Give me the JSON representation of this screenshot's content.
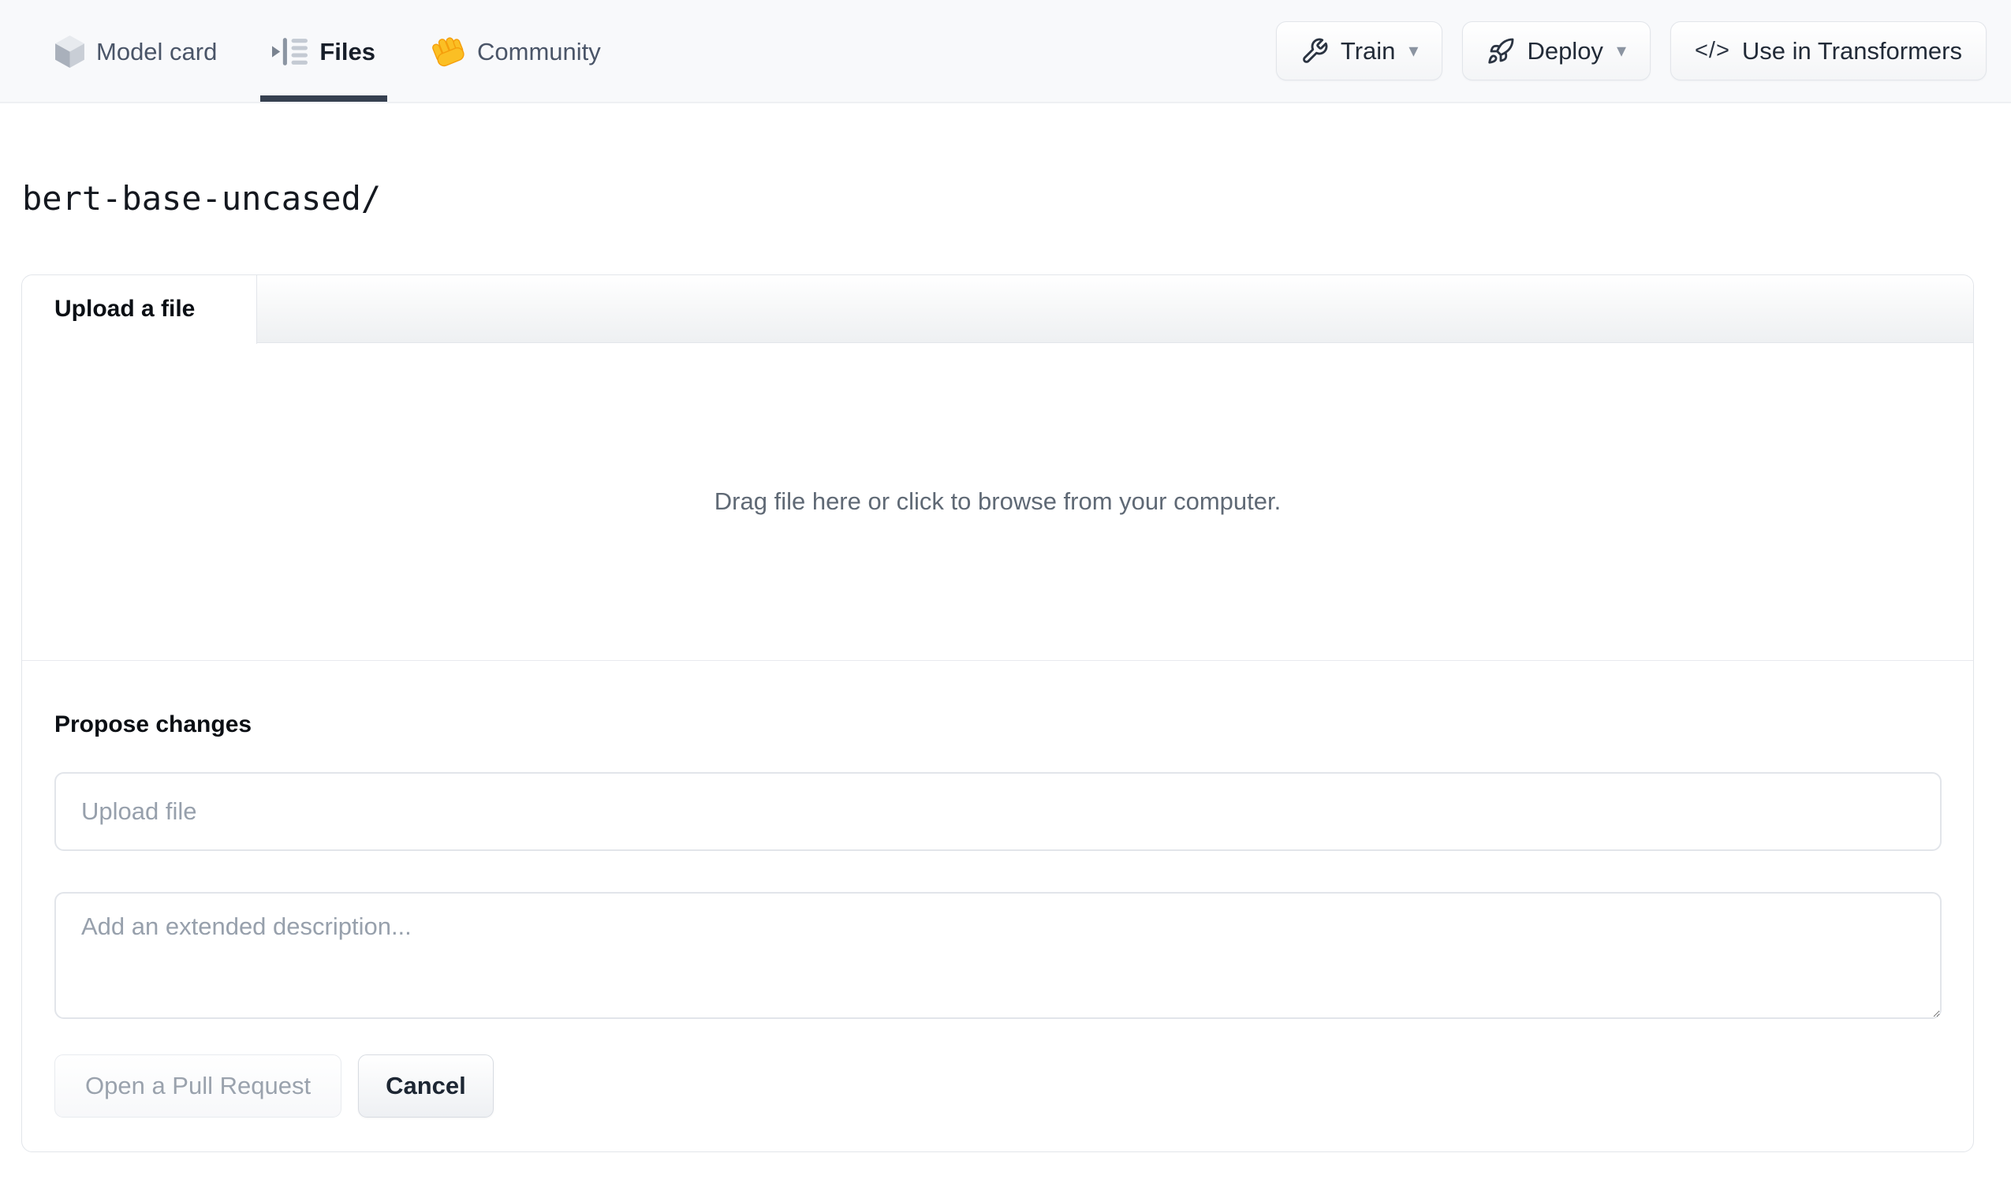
{
  "nav": {
    "tabs": [
      {
        "label": "Model card",
        "icon": "cube-icon",
        "active": false
      },
      {
        "label": "Files",
        "icon": "file-versions-icon",
        "active": true
      },
      {
        "label": "Community",
        "icon": "waving-hand-icon",
        "active": false
      }
    ],
    "actions": [
      {
        "label": "Train",
        "icon": "wrench-icon",
        "has_dropdown": true
      },
      {
        "label": "Deploy",
        "icon": "rocket-icon",
        "has_dropdown": true
      },
      {
        "label": "Use in Transformers",
        "icon": "code-icon",
        "has_dropdown": false
      }
    ],
    "caret_glyph": "▾",
    "code_glyph": "</>"
  },
  "breadcrumb": {
    "path": "bert-base-uncased/"
  },
  "upload_card": {
    "tab_label": "Upload a file",
    "dropzone_text": "Drag file here or click to browse from your computer.",
    "propose": {
      "heading": "Propose changes",
      "file_placeholder": "Upload file",
      "file_value": "",
      "description_placeholder": "Add an extended description...",
      "description_value": "",
      "primary_button": "Open a Pull Request",
      "secondary_button": "Cancel",
      "primary_button_enabled": false
    }
  },
  "colors": {
    "active_tab_underline": "#364050",
    "nav_background": "#f8f9fb",
    "card_border": "#e2e5ea",
    "disabled_text": "#9aa2ad",
    "hand_emoji_orange": "#fbbf24",
    "placeholder_text": "#97a0ac"
  }
}
